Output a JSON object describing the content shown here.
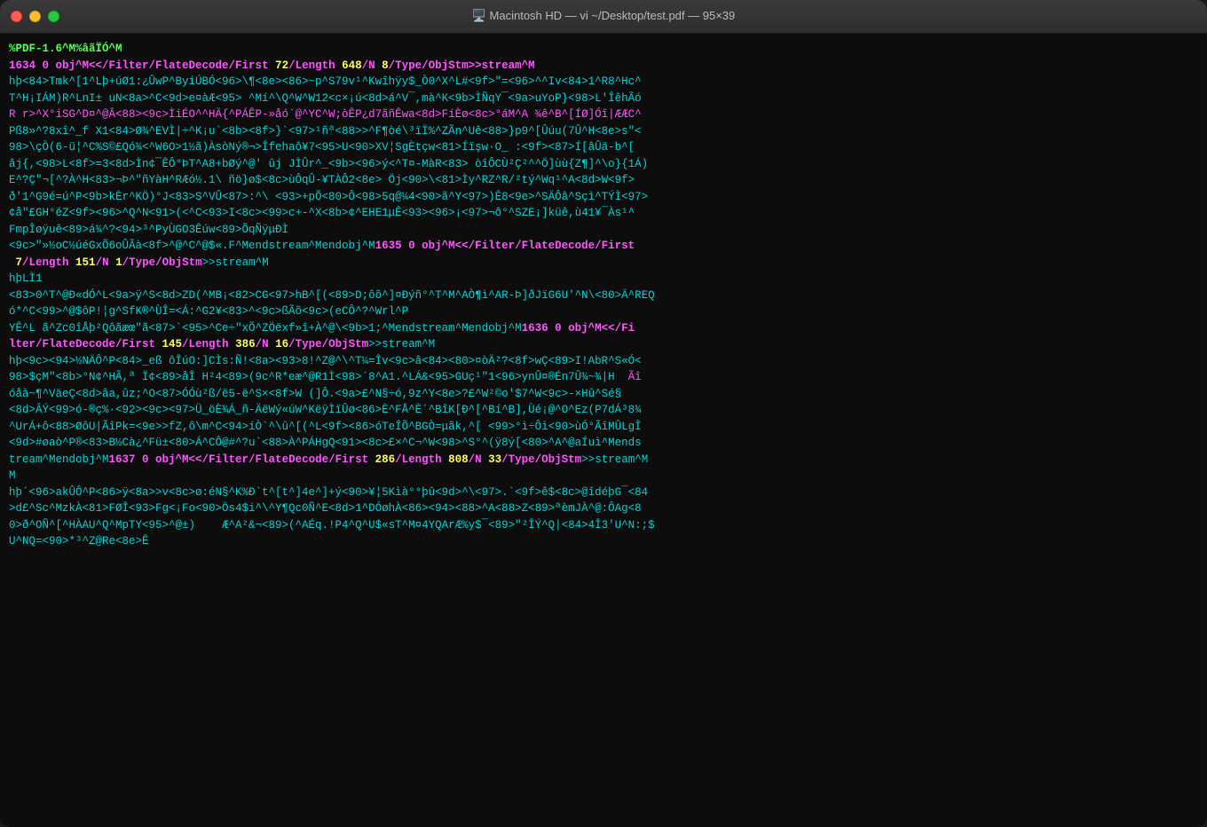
{
  "titlebar": {
    "title": "🖥️ Macintosh HD — vi ~/Desktop/test.pdf — 95×39"
  },
  "traffic_lights": {
    "close_label": "close",
    "minimize_label": "minimize",
    "maximize_label": "maximize"
  },
  "terminal": {
    "lines": [
      {
        "id": 1,
        "text": "%PDF-1.6^M%âãÏÓ^M",
        "color": "green",
        "bold": true
      },
      {
        "id": 2,
        "text": "1634 0 obj^M<</Filter/FlateDecode/First 72/Length 648/N 8/Type/ObjStm>>stream^M",
        "color": "mixed_1"
      },
      {
        "id": 3,
        "text": "hþ<84>Tmk^[1^Lþ+úØ1:¿ÛwP^ByiÚBÓ<96>\\¶<8e><86>~p^S79v¹^Kwîhÿy$_Ò0^X^L#<9f>\"=<96>^^Iv<84>1^R8^Hc^",
        "color": "cyan"
      },
      {
        "id": 4,
        "text": "T^H¡IÁM)R^LnI± uN<8a>^C<9d>e¤àÆ<95> ^Mí^\\Q^W^W12<c×¡ú<8d>á^V¯,mà^K<9b>ÌÑqY¯<9a>uYoP}<98>L'ÎêhÃó",
        "color": "cyan"
      },
      {
        "id": 5,
        "text": "R r>^X°iSG^D¤^@Â<88><9c>ÌiÉO^^HÄ{^PÁÊP-»åó`@^YC^W;òÊP¿d7ãñÊwa<8d>FíÈø<8c>°áM^A ¾ê^B^[ÍØ]Óî|ÆÆC^",
        "color": "magenta"
      },
      {
        "id": 6,
        "text": "Pß8»^?8xî^_f X1<84>Ø¾^EVÌ|÷^K¡u`<8b><8f>}`<97>¹ñª<88>>^F¶òé\\³ïÏ%^ZÃn^Uê<88>}p9^[Ûúu(7Û^H<8e>s\"<",
        "color": "cyan"
      },
      {
        "id": 7,
        "text": "98>\\çÒ(6-ü¦^C%S©£Qó¾<^W6O>1½ã)ÀsòNý®¬>Îfehaô¥7<95>U<90>XV¦SgÈtçw<81>Íïşw·O_ ∶<9f><87>Í[âÛä-b^[",
        "color": "cyan"
      },
      {
        "id": 8,
        "text": "âj{,<98>L<8f>=3<8d>Ìn¢¯ÊÔ°ÞT^A8+bØý^@' ûj JÌÛr^_<9b><96>ý<^T¤-MàR<83> òîÔCÙ²Ç²^^Ö]ùù{ZΩ]^\\o}{1Á)",
        "color": "cyan"
      },
      {
        "id": 9,
        "text": "E^?Ç¨¬[^?À^H<83>¬Þ^\"ñYàH^RÆó½.1\\ ñö}ø$<8c>ùÔq Û-¥TÀÔ2<8e> Öj<90>\\<81>Ìy^RZ^R/²tý^Wq¹^A<8d>W<9f>",
        "color": "cyan"
      },
      {
        "id": 10,
        "text": "ð'1^G9é=ú^P<9b>kÈr^KÖ)°J<83>S^VÛ<87>:^\\ <93>+pÕ<80>Ô<98>5q@¼4<90>ã^Y<97>)Ê8<9e>^SÄÔâ^Sçì^TÝÌ<97>",
        "color": "cyan"
      },
      {
        "id": 11,
        "text": "¢å¨£GH°éZ<9f><96>^Q^N<91>(<^C<93>I<8c><99>c+−^X<8b>¢^EHE1μÊ<93><96>¡<97>¬ô°^SZE¡]küê,ù41¥¯Às¹^",
        "color": "cyan"
      },
      {
        "id": 12,
        "text": "FmpÎøÿuê<89>á¾^?<94>³^PyÙGO3Êúw<89>ÕqÑÿμÐÌ",
        "color": "cyan"
      },
      {
        "id": 13,
        "text": "<9c>\"¨»½oC½úéGxÕ6oÛÃà<8f>^@^C^@$«.F^Mendstream^Mendobj^M1635 0 obj^M<</Filter/FlateDecode/First",
        "color": "mixed_2"
      },
      {
        "id": 14,
        "text": " 7/Length 151/N 1/Type/ObjStm>>stream^M",
        "color": "mixed_3"
      },
      {
        "id": 15,
        "text": "hÞLÌ1",
        "color": "cyan"
      },
      {
        "id": 16,
        "text": "<83>0^T^@Ð«dÓ^L<9a>ÿ^S<8d>ZD(^MB¡<82>CG<97>hB^[(<89>D;ôõ^]¤Ðýñ°^T^M^AÒ¶ì^AR-Þ]ðJïG6U'^N\\<80>Ä^REQ",
        "color": "cyan"
      },
      {
        "id": 17,
        "text": "ó*^C<99>^@$ôP!¦g^SfK®^ÙÎ=<Á:^G2¥<83>^<9c>ßÃõ<9c>(eCÔ^?^Wrl^P",
        "color": "cyan"
      },
      {
        "id": 18,
        "text": "YÊ^L ã^Zc0îÅþ²Qôãæœ¨ã<87>`<95>^Ce÷¨xÕ^ZÖëxf»î+À^@^\\<9b>1;^Mendstream^Mendobj^M1636 0 obj^M<</Fi",
        "color": "mixed_4"
      },
      {
        "id": 19,
        "text": "lter/FlateDecode/First 145/Length 386/N 16/Type/ObjStm>>stream^M",
        "color": "mixed_5"
      },
      {
        "id": 20,
        "text": "hþ<9c><94>½NÄÔ^P<84>_eß ôÎúO:]CÌs:Ñ!<8a><93>8!^Z@^\\^T¼=Îv<9c>â<84><80>¤òÄ²?<8f>wÇ<89>I!AbR^S«Ó<",
        "color": "cyan"
      },
      {
        "id": 21,
        "text": "98>$çM\"<8b>°N¢^HÃ,ª Ï¢<89>åÎ H²4<89>(9c^R*eæ^@R1Ì<98>´8^A1.^LÁ&<95>GUç¹\"1<96>ynÛ¤®Én7Û¾~¾|H  Ãî",
        "color": "cyan"
      },
      {
        "id": 22,
        "text": "óåà~¶^VäeÇ<8d>âa,ûz;^O<87>ÓÓù²ß/ë5-ë^S×<8f>W (]Ô.<9a>£^N§÷ó,9z^Y<8e>?£^W²©o'$7^W<9c>-×Hû^Sé§",
        "color": "cyan"
      },
      {
        "id": 23,
        "text": "<8d>ÂÝ<99>ó-®ç%·<92><9c><97>Ü_öÈ¾Á_ñ-ÄëWý«úW^KëÿÌïÛø<86>È^FÅ^È´^BîK[Ð^[^Bí^B],Ùé¡@^O^Ez(P7dÁ³8¾",
        "color": "cyan"
      },
      {
        "id": 24,
        "text": "^UrÁ+ô<88>ØôU|ÃîPk=<9e>>fZ,ô\\m^C<94>íÒ`^\\û^[(^L<9f><86>óTeÎÕ^BGÒ=μãk,^[ <99>°ì÷Ôì<90>ùÓ°ÃîMÛLgÎ",
        "color": "cyan"
      },
      {
        "id": 25,
        "text": "<9d>#øaò^P®<83>B½Cà¿^Fü±<80>Á^CÔ@#^?u`<88>À^PÁHgQ<91><8c>£×^C¬^W<98>^S°^(ÿ8ý[<80>^A^@aÍuì^Mends",
        "color": "cyan"
      },
      {
        "id": 26,
        "text": "tream^Mendobj^M1637 0 obj^M<</Filter/FlateDecode/First 286/Length 808/N 33/Type/ObjStm>>stream^M",
        "color": "mixed_6"
      },
      {
        "id": 27,
        "text": "M",
        "color": "cyan"
      },
      {
        "id": 28,
        "text": "hþ´<96>akÛÔ^P<86>ÿ<8a>>v<8c>ø:éN§^K%Ð`t^[t^]4e^]+ý<90>¥¦5Kìà°°þû<9d>^\\<97>.`<9f>ê$<8c>@îdéþG¯<84",
        "color": "cyan"
      },
      {
        "id": 29,
        "text": ">d£^Sc^MzkÀ<81>FØÎ<93>Fg<¡Fo<90>Ös4$i^\\^Y¶Qc0Ñ^E<8d>1^DÓøhÀ<86><94><88>^A<88>Z<89>ªèmJÀ^@:ÔAg<8",
        "color": "cyan"
      },
      {
        "id": 30,
        "text": "0>ð^OÑ^[^HÀAU^Q^MpTY<95>^@±)    Æ^A²&¬<89>(^AÉq.!P4^Q^U$«sT^M¤4YQArÆ%y$¯<89>\"²ÎÝ^Q|<84>4Î3'U^N:;$",
        "color": "cyan"
      },
      {
        "id": 31,
        "text": "U^NQ=<90>*³^Z@Re<8e>Ê",
        "color": "cyan"
      }
    ]
  }
}
